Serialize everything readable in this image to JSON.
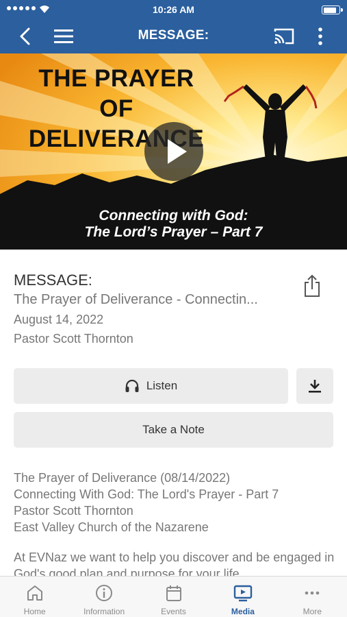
{
  "status_bar": {
    "time": "10:26 AM"
  },
  "header": {
    "title": "MESSAGE:"
  },
  "hero": {
    "title_line1": "THE PRAYER",
    "title_line2": "OF",
    "title_line3": "DELIVERANCE",
    "subtitle_line1": "Connecting with God:",
    "subtitle_line2": "The Lord’s Prayer – Part 7"
  },
  "message": {
    "label": "MESSAGE:",
    "title": "The Prayer of Deliverance - Connectin...",
    "date": "August 14, 2022",
    "speaker": "Pastor Scott Thornton"
  },
  "actions": {
    "listen_label": "Listen",
    "note_label": "Take a Note"
  },
  "description": {
    "lines": [
      "The Prayer of Deliverance (08/14/2022)",
      "Connecting With God: The Lord's Prayer - Part 7",
      "Pastor Scott Thornton",
      "East Valley Church of the Nazarene"
    ],
    "paragraph": "At EVNaz we want to help you discover and be engaged in God's good plan and purpose for your life"
  },
  "tabs": [
    {
      "label": "Home",
      "icon": "home-icon"
    },
    {
      "label": "Information",
      "icon": "info-icon"
    },
    {
      "label": "Events",
      "icon": "calendar-icon"
    },
    {
      "label": "Media",
      "icon": "media-icon",
      "active": true
    },
    {
      "label": "More",
      "icon": "more-icon"
    }
  ],
  "colors": {
    "brand": "#2b5f9e",
    "button_bg": "#ececec",
    "secondary_text": "#777777"
  }
}
